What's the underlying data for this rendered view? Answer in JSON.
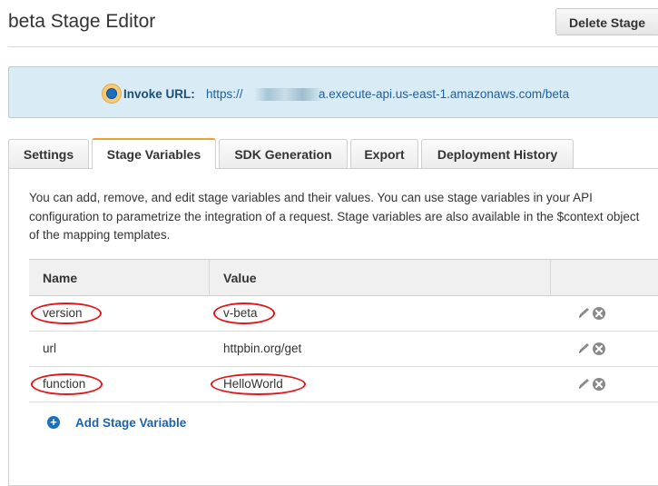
{
  "page": {
    "title": "beta Stage Editor",
    "delete_button": "Delete Stage"
  },
  "invoke": {
    "label": "Invoke URL:",
    "url_visible_start": "https://",
    "url_visible_end": "a.execute-api.us-east-1.amazonaws.com/beta"
  },
  "tabs": [
    {
      "label": "Settings",
      "active": false
    },
    {
      "label": "Stage Variables",
      "active": true
    },
    {
      "label": "SDK Generation",
      "active": false
    },
    {
      "label": "Export",
      "active": false
    },
    {
      "label": "Deployment History",
      "active": false
    }
  ],
  "stage_variables": {
    "description": "You can add, remove, and edit stage variables and their values. You can use stage variables in your API configuration to parametrize the integration of a request. Stage variables are also available in the $context object of the mapping templates.",
    "columns": [
      "Name",
      "Value"
    ],
    "rows": [
      {
        "name": "version",
        "value": "v-beta",
        "highlighted": true
      },
      {
        "name": "url",
        "value": "httpbin.org/get",
        "highlighted": false
      },
      {
        "name": "function",
        "value": "HelloWorld",
        "highlighted": true
      }
    ],
    "add_label": "Add Stage Variable"
  },
  "icons": {
    "row_actions": [
      "pencil-icon",
      "remove-icon"
    ],
    "add": "plus-circle-icon",
    "invoke": "radio-dot-icon"
  },
  "colors": {
    "accent_tab": "#f0a030",
    "link": "#1b63ad",
    "banner_bg": "#d9ecf5",
    "annotation": "#e0161b"
  }
}
